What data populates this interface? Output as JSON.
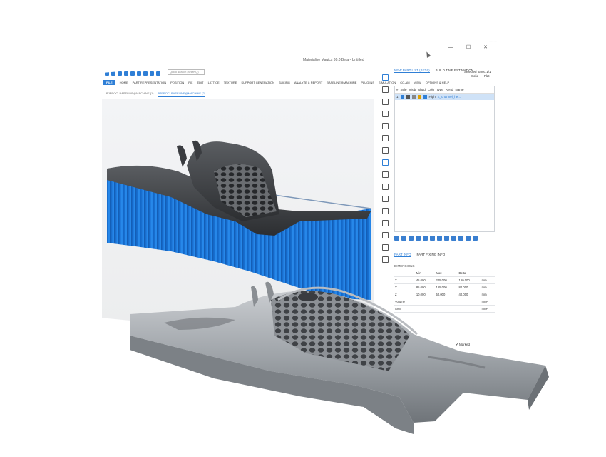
{
  "window": {
    "title": "Materialise Magics 30.0 Beta - Untitled",
    "controls": [
      "—",
      "☐",
      "✕"
    ]
  },
  "quick_access": {
    "search_placeholder": "Quick search (Shift+Q)"
  },
  "ribbon": {
    "file": "FILE",
    "tabs": [
      "HOME",
      "PART REPRESENTATION",
      "POSITION",
      "FIX",
      "EDIT",
      "LATTICE",
      "TEXTURE",
      "SUPPORT GENERATION",
      "SLICING",
      "ANALYZE & REPORT",
      "BASELINE@MACHINE",
      "PLUG INS",
      "SIMULATION",
      "CO-AM",
      "VIEW",
      "OPTIONS & HELP"
    ]
  },
  "document_tabs": [
    "BJPROC: BASELINE@MACHINE (1)",
    "BJPROC: BASELINE@MACHINE (2)"
  ],
  "part_list": {
    "tabs": [
      "NEW PART LIST (BETA)",
      "BUILD TIME ESTIMATION"
    ],
    "selected_parts": "Selected parts: 1/1",
    "extra_columns": [
      "Solid",
      "Flat"
    ],
    "columns": [
      "#",
      "Sele",
      "Visib",
      "Shad",
      "Colo",
      "Type",
      "Rend",
      "Name"
    ],
    "rows": [
      {
        "index": "1",
        "render": "High",
        "name": "Z_channel_he..."
      }
    ]
  },
  "part_info": {
    "tabs": [
      "PART INFO",
      "PART FIXING INFO"
    ],
    "section": "DIMENSIONS",
    "headers": [
      "Min",
      "Max",
      "Delta",
      ""
    ],
    "rows": [
      {
        "axis": "X",
        "min": "45.000",
        "max": "205.000",
        "delta": "160.000",
        "unit": "mm"
      },
      {
        "axis": "Y",
        "min": "85.000",
        "max": "165.000",
        "delta": "80.000",
        "unit": "mm"
      },
      {
        "axis": "Z",
        "min": "10.000",
        "max": "50.000",
        "delta": "40.000",
        "unit": "mm"
      },
      {
        "axis": "Volume",
        "min": "",
        "max": "",
        "delta": "",
        "unit": "mm³"
      },
      {
        "axis": "Area",
        "min": "",
        "max": "",
        "delta": "",
        "unit": "mm²"
      }
    ],
    "marked": "Marked"
  },
  "colors": {
    "accent": "#2f7fd6",
    "support_blue": "#1f7fe0",
    "part_metal": "#9ea3a8",
    "part_dark": "#3d3f43"
  }
}
